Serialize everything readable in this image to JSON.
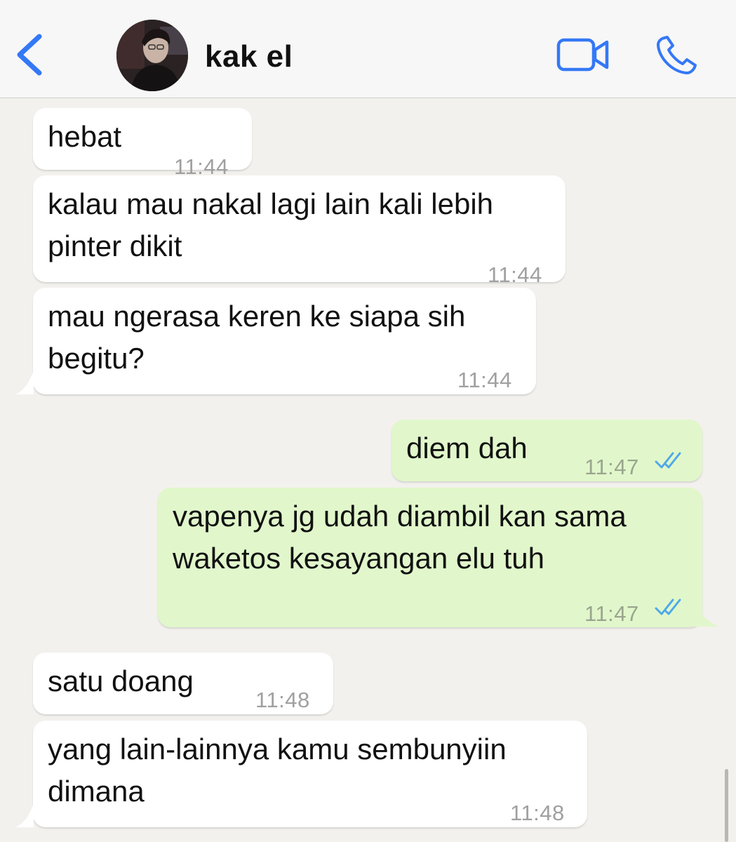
{
  "header": {
    "contact_name": "kak el",
    "back_icon": "chevron-left-icon",
    "video_icon": "video-camera-icon",
    "call_icon": "phone-icon",
    "accent_color": "#3478f6"
  },
  "messages": [
    {
      "direction": "in",
      "text": "hebat",
      "time": "11:44"
    },
    {
      "direction": "in",
      "text": "kalau mau nakal lagi lain kali lebih\npinter dikit",
      "time": "11:44"
    },
    {
      "direction": "in",
      "text": "mau ngerasa keren ke siapa sih\nbegitu?",
      "time": "11:44"
    },
    {
      "direction": "out",
      "text": "diem dah",
      "time": "11:47",
      "status": "read"
    },
    {
      "direction": "out",
      "text": "vapenya jg udah diambil kan sama\nwaketos kesayangan elu tuh",
      "time": "11:47",
      "status": "read"
    },
    {
      "direction": "in",
      "text": "satu doang",
      "time": "11:48"
    },
    {
      "direction": "in",
      "text": "yang lain-lainnya kamu sembunyiin\ndimana",
      "time": "11:48"
    }
  ],
  "colors": {
    "incoming_bubble": "#ffffff",
    "outgoing_bubble": "#e1f7cb",
    "background": "#f3f1ed",
    "read_ticks": "#4fa8e8"
  }
}
